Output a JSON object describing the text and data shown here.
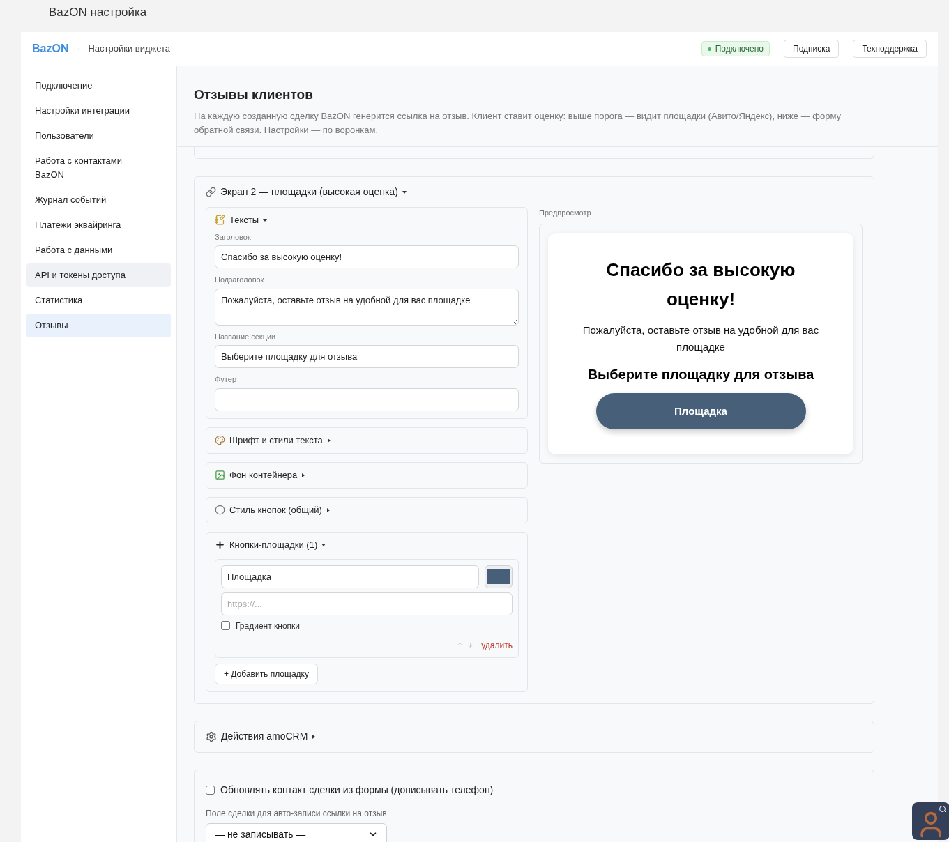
{
  "window": {
    "title": "BazON настройка"
  },
  "header": {
    "brand": "BazON",
    "separator": "·",
    "page": "Настройки виджета",
    "status": {
      "label": "Подключено",
      "connected": true
    },
    "buttons": [
      "Подписка",
      "Техподдержка"
    ]
  },
  "sidebar": {
    "items": [
      {
        "label": "Подключение",
        "selected": false,
        "hovered": false
      },
      {
        "label": "Настройки интеграции",
        "selected": false,
        "hovered": false
      },
      {
        "label": "Пользователи",
        "selected": false,
        "hovered": false
      },
      {
        "label": "Работа с контактами BazON",
        "selected": false,
        "hovered": false
      },
      {
        "label": "Журнал событий",
        "selected": false,
        "hovered": false
      },
      {
        "label": "Платежи эквайринга",
        "selected": false,
        "hovered": false
      },
      {
        "label": "Работа с данными",
        "selected": false,
        "hovered": false
      },
      {
        "label": "API и токены доступа",
        "selected": false,
        "hovered": true
      },
      {
        "label": "Статистика",
        "selected": false,
        "hovered": false
      },
      {
        "label": "Отзывы",
        "selected": true,
        "hovered": false
      }
    ]
  },
  "page": {
    "title": "Отзывы клиентов",
    "description": "На каждую созданную сделку BazON генерится ссылка на отзыв. Клиент ставит оценку: выше порога — видит площадки (Авито/Яндекс), ниже — форму обратной связи. Настройки — по воронкам."
  },
  "screen": {
    "title": "Экран 2 — площадки (высокая оценка)",
    "expanded": true,
    "sections": [
      {
        "kind": "texts",
        "title": "Тексты",
        "expanded": true,
        "fields": [
          {
            "kind": "input",
            "label": "Заголовок",
            "value": "Спасибо за высокую оценку!"
          },
          {
            "kind": "textarea",
            "label": "Подзаголовок",
            "value": "Пожалуйста, оставьте отзыв на удобной для вас площадке"
          },
          {
            "kind": "input",
            "label": "Название секции",
            "value": "Выберите площадку для отзыва"
          },
          {
            "kind": "input",
            "label": "Футер"
          }
        ]
      },
      {
        "kind": "font",
        "title": "Шрифт и стили текста",
        "expanded": false
      },
      {
        "kind": "background",
        "title": "Фон контейнера",
        "expanded": false
      },
      {
        "kind": "button_style",
        "title": "Стиль кнопок (общий)",
        "expanded": false
      },
      {
        "kind": "platforms",
        "title": "Кнопки-площадки (1)",
        "expanded": true,
        "items": [
          {
            "name": "Площадка",
            "url_placeholder": "https://...",
            "color": "#475f78",
            "gradient": {
              "label": "Градиент кнопки",
              "checked": false
            },
            "delete_label": "удалить"
          }
        ],
        "add_button": "+ Добавить площадку"
      }
    ]
  },
  "preview": {
    "label": "Предпросмотр",
    "title": "Спасибо за высокую оценку!",
    "subtitle": "Пожалуйста, оставьте отзыв на удобной для вас площадке",
    "section_title": "Выберите площадку для отзыва",
    "buttons": [
      {
        "label": "Площадка",
        "color": "#475f78"
      }
    ]
  },
  "amo_actions": {
    "title": "Действия amoCRM",
    "expanded": false
  },
  "options": {
    "update_contact": {
      "label": "Обновлять контакт сделки из формы (дописывать телефон)",
      "checked": false
    },
    "deal_field": {
      "label": "Поле сделки для авто-записи ссылки на отзыв",
      "value": "— не записывать —"
    }
  }
}
